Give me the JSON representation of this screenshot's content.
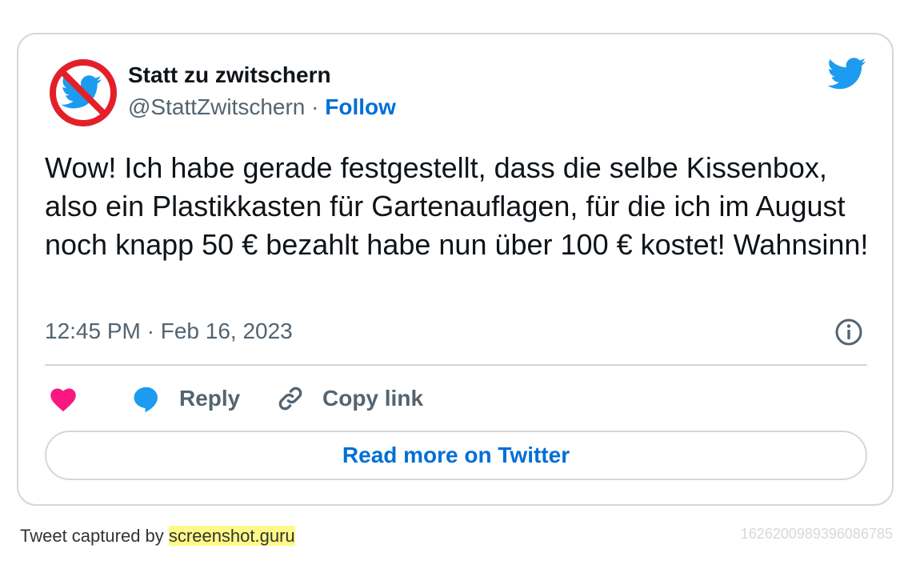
{
  "tweet": {
    "author": {
      "name": "Statt zu zwitschern",
      "handle": "@StattZwitschern",
      "separator": " · ",
      "follow_label": "Follow"
    },
    "text": "Wow! Ich habe gerade festgestellt, dass die selbe Kissenbox, also ein Plastikkasten für Gartenauflagen, für die ich im August noch knapp 50 € bezahlt habe nun über 100 € kostet! Wahnsinn!",
    "timestamp": "12:45 PM · Feb 16, 2023",
    "actions": {
      "like_icon": "heart-icon",
      "reply_label": "Reply",
      "reply_icon": "speech-bubble-icon",
      "copy_label": "Copy link",
      "copy_icon": "link-icon"
    },
    "read_more_label": "Read more on Twitter"
  },
  "footer": {
    "captured_prefix": "Tweet captured by ",
    "brand": "screenshot.guru",
    "tweet_id": "1626200989396086785"
  },
  "colors": {
    "accent": "#006fd6",
    "twitter_blue": "#1d9bf0",
    "like": "#f91880",
    "muted": "#536471",
    "border": "#cfd9de",
    "highlight": "#fff988",
    "forbidden_red": "#e3202a"
  }
}
